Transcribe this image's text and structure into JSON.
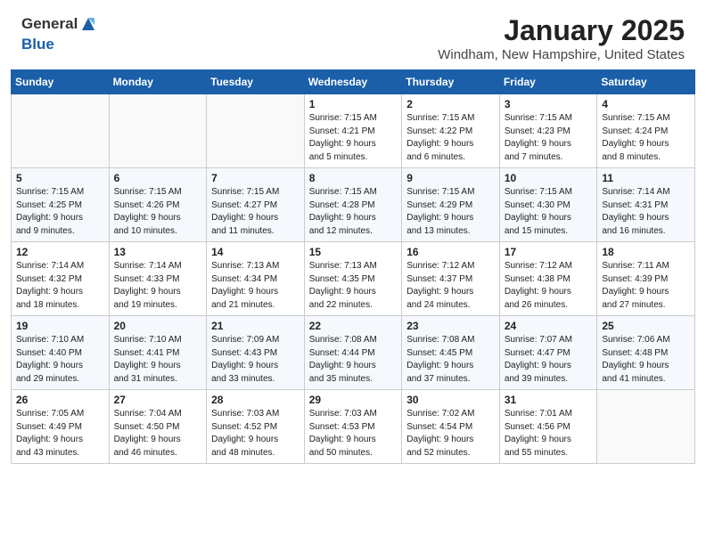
{
  "header": {
    "logo_general": "General",
    "logo_blue": "Blue",
    "title": "January 2025",
    "location": "Windham, New Hampshire, United States"
  },
  "weekdays": [
    "Sunday",
    "Monday",
    "Tuesday",
    "Wednesday",
    "Thursday",
    "Friday",
    "Saturday"
  ],
  "weeks": [
    [
      {
        "day": "",
        "info": ""
      },
      {
        "day": "",
        "info": ""
      },
      {
        "day": "",
        "info": ""
      },
      {
        "day": "1",
        "info": "Sunrise: 7:15 AM\nSunset: 4:21 PM\nDaylight: 9 hours\nand 5 minutes."
      },
      {
        "day": "2",
        "info": "Sunrise: 7:15 AM\nSunset: 4:22 PM\nDaylight: 9 hours\nand 6 minutes."
      },
      {
        "day": "3",
        "info": "Sunrise: 7:15 AM\nSunset: 4:23 PM\nDaylight: 9 hours\nand 7 minutes."
      },
      {
        "day": "4",
        "info": "Sunrise: 7:15 AM\nSunset: 4:24 PM\nDaylight: 9 hours\nand 8 minutes."
      }
    ],
    [
      {
        "day": "5",
        "info": "Sunrise: 7:15 AM\nSunset: 4:25 PM\nDaylight: 9 hours\nand 9 minutes."
      },
      {
        "day": "6",
        "info": "Sunrise: 7:15 AM\nSunset: 4:26 PM\nDaylight: 9 hours\nand 10 minutes."
      },
      {
        "day": "7",
        "info": "Sunrise: 7:15 AM\nSunset: 4:27 PM\nDaylight: 9 hours\nand 11 minutes."
      },
      {
        "day": "8",
        "info": "Sunrise: 7:15 AM\nSunset: 4:28 PM\nDaylight: 9 hours\nand 12 minutes."
      },
      {
        "day": "9",
        "info": "Sunrise: 7:15 AM\nSunset: 4:29 PM\nDaylight: 9 hours\nand 13 minutes."
      },
      {
        "day": "10",
        "info": "Sunrise: 7:15 AM\nSunset: 4:30 PM\nDaylight: 9 hours\nand 15 minutes."
      },
      {
        "day": "11",
        "info": "Sunrise: 7:14 AM\nSunset: 4:31 PM\nDaylight: 9 hours\nand 16 minutes."
      }
    ],
    [
      {
        "day": "12",
        "info": "Sunrise: 7:14 AM\nSunset: 4:32 PM\nDaylight: 9 hours\nand 18 minutes."
      },
      {
        "day": "13",
        "info": "Sunrise: 7:14 AM\nSunset: 4:33 PM\nDaylight: 9 hours\nand 19 minutes."
      },
      {
        "day": "14",
        "info": "Sunrise: 7:13 AM\nSunset: 4:34 PM\nDaylight: 9 hours\nand 21 minutes."
      },
      {
        "day": "15",
        "info": "Sunrise: 7:13 AM\nSunset: 4:35 PM\nDaylight: 9 hours\nand 22 minutes."
      },
      {
        "day": "16",
        "info": "Sunrise: 7:12 AM\nSunset: 4:37 PM\nDaylight: 9 hours\nand 24 minutes."
      },
      {
        "day": "17",
        "info": "Sunrise: 7:12 AM\nSunset: 4:38 PM\nDaylight: 9 hours\nand 26 minutes."
      },
      {
        "day": "18",
        "info": "Sunrise: 7:11 AM\nSunset: 4:39 PM\nDaylight: 9 hours\nand 27 minutes."
      }
    ],
    [
      {
        "day": "19",
        "info": "Sunrise: 7:10 AM\nSunset: 4:40 PM\nDaylight: 9 hours\nand 29 minutes."
      },
      {
        "day": "20",
        "info": "Sunrise: 7:10 AM\nSunset: 4:41 PM\nDaylight: 9 hours\nand 31 minutes."
      },
      {
        "day": "21",
        "info": "Sunrise: 7:09 AM\nSunset: 4:43 PM\nDaylight: 9 hours\nand 33 minutes."
      },
      {
        "day": "22",
        "info": "Sunrise: 7:08 AM\nSunset: 4:44 PM\nDaylight: 9 hours\nand 35 minutes."
      },
      {
        "day": "23",
        "info": "Sunrise: 7:08 AM\nSunset: 4:45 PM\nDaylight: 9 hours\nand 37 minutes."
      },
      {
        "day": "24",
        "info": "Sunrise: 7:07 AM\nSunset: 4:47 PM\nDaylight: 9 hours\nand 39 minutes."
      },
      {
        "day": "25",
        "info": "Sunrise: 7:06 AM\nSunset: 4:48 PM\nDaylight: 9 hours\nand 41 minutes."
      }
    ],
    [
      {
        "day": "26",
        "info": "Sunrise: 7:05 AM\nSunset: 4:49 PM\nDaylight: 9 hours\nand 43 minutes."
      },
      {
        "day": "27",
        "info": "Sunrise: 7:04 AM\nSunset: 4:50 PM\nDaylight: 9 hours\nand 46 minutes."
      },
      {
        "day": "28",
        "info": "Sunrise: 7:03 AM\nSunset: 4:52 PM\nDaylight: 9 hours\nand 48 minutes."
      },
      {
        "day": "29",
        "info": "Sunrise: 7:03 AM\nSunset: 4:53 PM\nDaylight: 9 hours\nand 50 minutes."
      },
      {
        "day": "30",
        "info": "Sunrise: 7:02 AM\nSunset: 4:54 PM\nDaylight: 9 hours\nand 52 minutes."
      },
      {
        "day": "31",
        "info": "Sunrise: 7:01 AM\nSunset: 4:56 PM\nDaylight: 9 hours\nand 55 minutes."
      },
      {
        "day": "",
        "info": ""
      }
    ]
  ]
}
